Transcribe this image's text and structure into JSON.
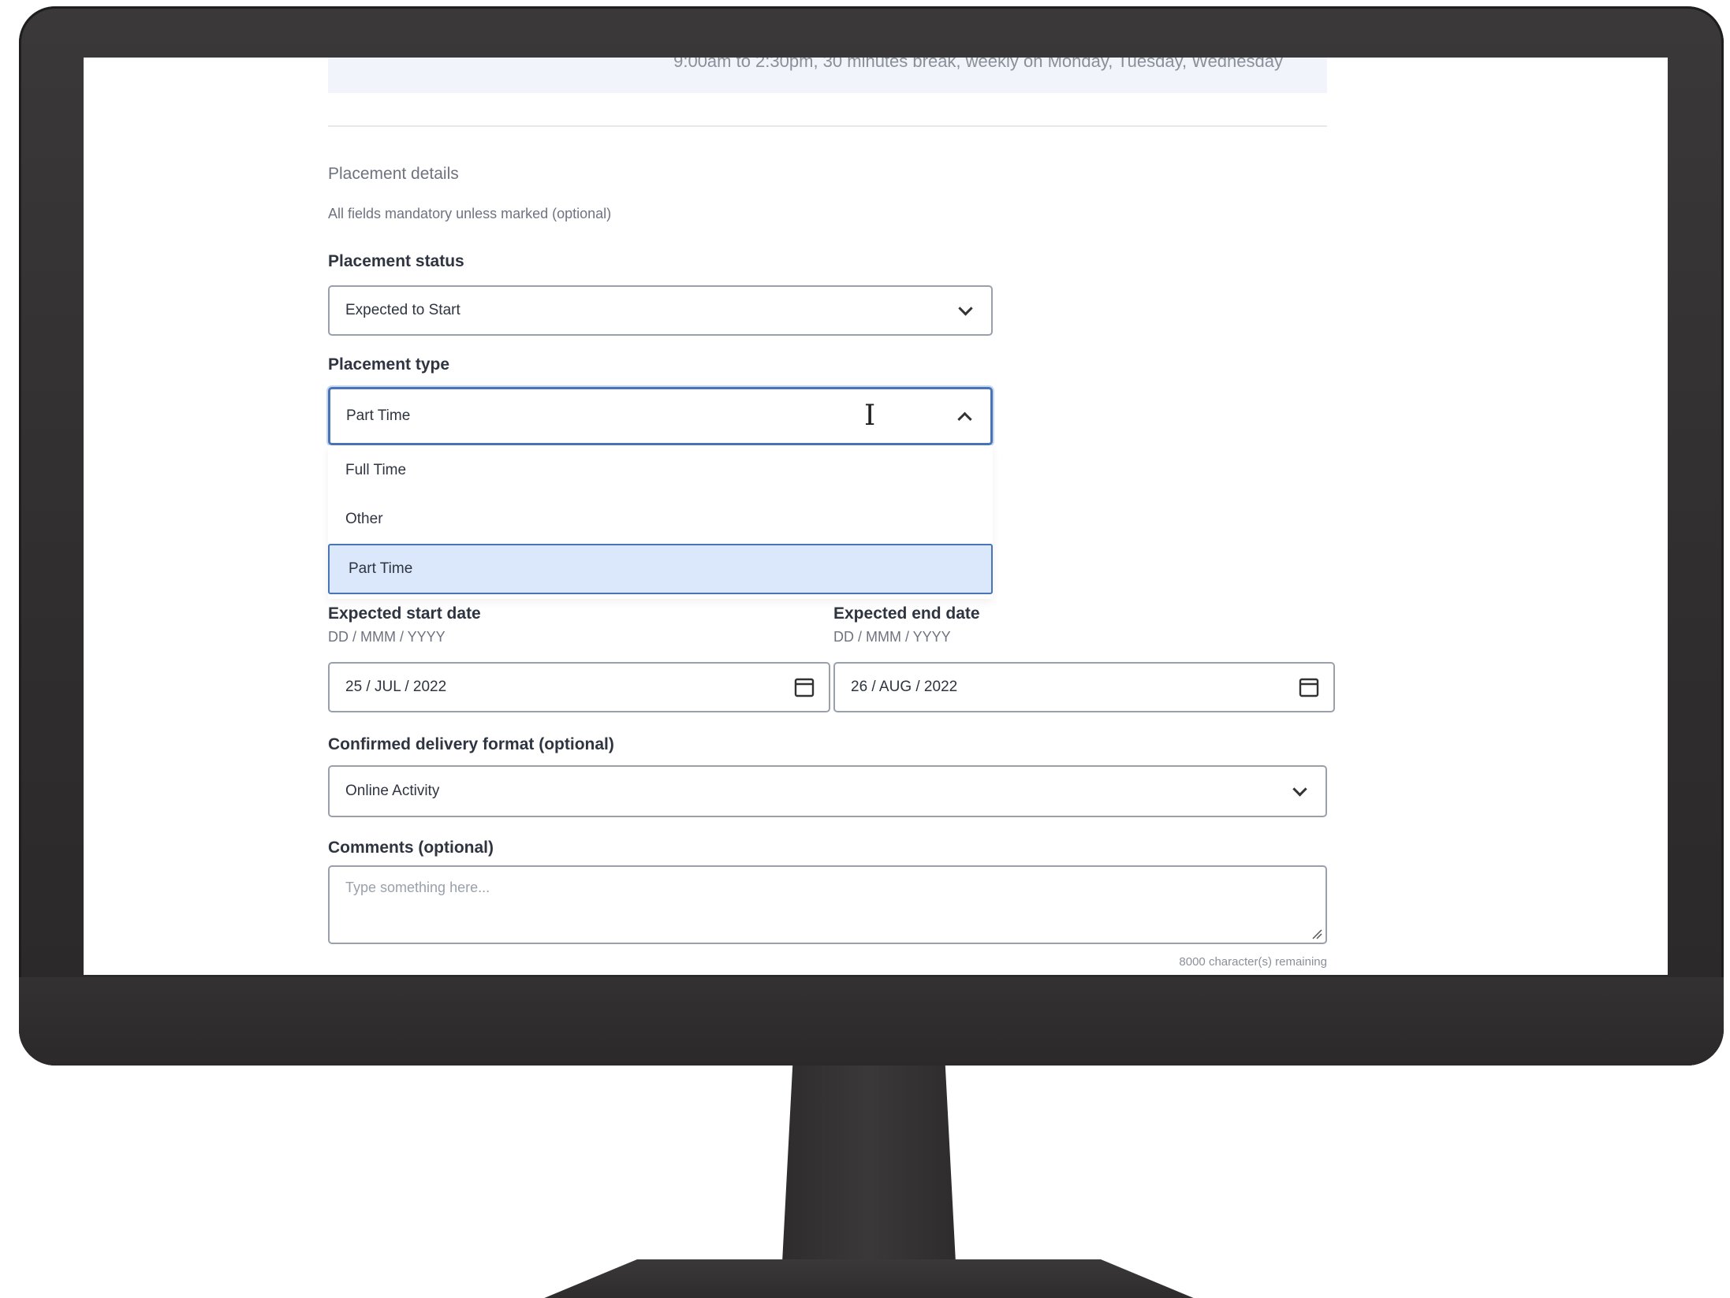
{
  "top_panel": {
    "schedule_text": "9:00am to 2:30pm, 30 minutes break, weekly on Monday, Tuesday, Wednesday"
  },
  "section": {
    "title": "Placement details",
    "subtitle": "All fields mandatory unless marked (optional)"
  },
  "placement_status": {
    "label": "Placement status",
    "value": "Expected to Start"
  },
  "placement_type": {
    "label": "Placement type",
    "value": "Part Time",
    "options": [
      "Full Time",
      "Other",
      "Part Time"
    ]
  },
  "start_date": {
    "label": "Expected start date",
    "hint": "DD / MMM / YYYY",
    "value": "25 / JUL / 2022"
  },
  "end_date": {
    "label": "Expected end date",
    "hint": "DD / MMM / YYYY",
    "value": "26 / AUG / 2022"
  },
  "delivery_format": {
    "label": "Confirmed delivery format (optional)",
    "value": "Online Activity"
  },
  "comments": {
    "label": "Comments (optional)",
    "placeholder": "Type something here...",
    "counter": "8000 character(s) remaining"
  },
  "icons": {
    "calendar": "calendar-icon",
    "chevron": "chevron-down-icon",
    "cursor": "text-cursor-icon"
  }
}
